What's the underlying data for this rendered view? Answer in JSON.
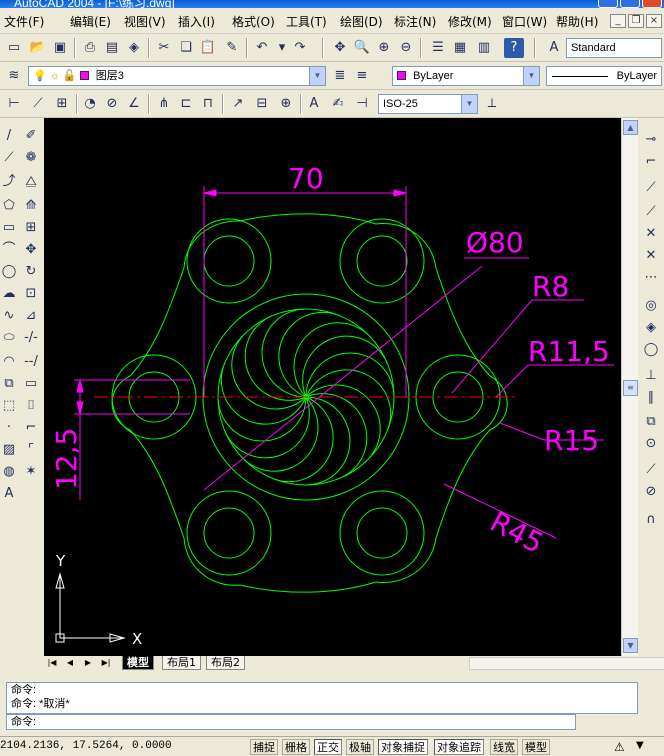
{
  "window": {
    "title": "AutoCAD 2004 - [F:\\练习.dwg]"
  },
  "menu": [
    "文件(F)",
    "编辑(E)",
    "视图(V)",
    "插入(I)",
    "格式(O)",
    "工具(T)",
    "绘图(D)",
    "标注(N)",
    "修改(M)",
    "窗口(W)",
    "帮助(H)"
  ],
  "toolbar": {
    "text_style": "Standard",
    "layer": "图层3",
    "color": "ByLayer",
    "linetype": "ByLayer",
    "dim_style": "ISO-25"
  },
  "drawing": {
    "dim_width": "70",
    "dim_diameter": "Ø80",
    "dim_r8": "R8",
    "dim_r11": "R11,5",
    "dim_r15": "R15",
    "dim_r45": "R45",
    "dim_height": "12,5",
    "axis_y": "Y",
    "axis_x": "X",
    "colors": {
      "geometry": "#00ff00",
      "dimension": "#ff00ff",
      "centerline": "#ff0000",
      "background": "#000000"
    }
  },
  "tabs": [
    "模型",
    "布局1",
    "布局2"
  ],
  "command": {
    "line1": "命令:",
    "line2": "命令: *取消*",
    "prompt": "命令:"
  },
  "status": {
    "coords": "2104.2136,  17.5264,  0.0000",
    "buttons": [
      "捕捉",
      "栅格",
      "正交",
      "极轴",
      "对象捕捉",
      "对象追踪",
      "线宽",
      "模型"
    ]
  }
}
